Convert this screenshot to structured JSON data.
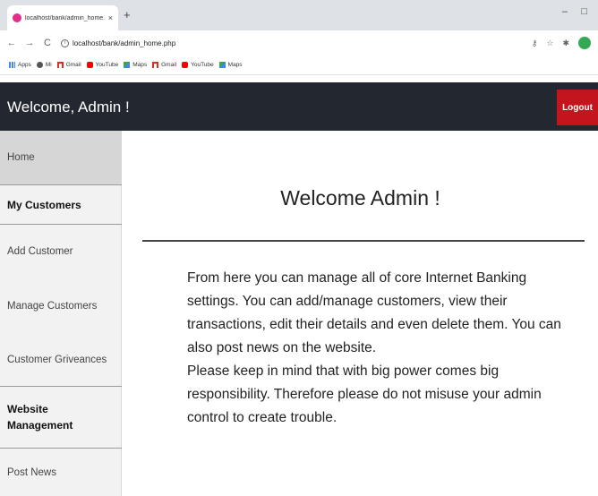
{
  "browser": {
    "tab_title": "localhost/bank/admin_home.php",
    "tab_close": "×",
    "new_tab": "+",
    "minimize": "–",
    "restore": "□",
    "back": "←",
    "forward": "→",
    "reload": "C",
    "url": "localhost/bank/admin_home.php",
    "bookmarks": [
      {
        "label": "Apps",
        "icon": "apps-icon"
      },
      {
        "label": "Mi",
        "icon": "mi-icon"
      },
      {
        "label": "Gmail",
        "icon": "gmail-icon"
      },
      {
        "label": "YouTube",
        "icon": "youtube-icon"
      },
      {
        "label": "Maps",
        "icon": "maps-icon"
      },
      {
        "label": "Gmail",
        "icon": "gmail-icon"
      },
      {
        "label": "YouTube",
        "icon": "youtube-icon"
      },
      {
        "label": "Maps",
        "icon": "maps-icon"
      }
    ]
  },
  "header": {
    "welcome": "Welcome,  Admin !",
    "logout": "Logout",
    "bg_color": "#232830",
    "logout_color": "#c4141e"
  },
  "sidebar": {
    "home": "Home",
    "my_customers": "My Customers",
    "add_customer": "Add Customer",
    "manage_customers": "Manage Customers",
    "customer_grievances": "Customer Griveances",
    "website_management_line1": "Website",
    "website_management_line2": "Management",
    "post_news": "Post News"
  },
  "main": {
    "title": "Welcome Admin !",
    "paragraph1": "From here you can manage all of core Internet Banking settings. You can add/manage customers, view their transactions, edit their details and even delete them. You can also post news on the website.",
    "paragraph2": "Please keep in mind that with big power comes big responsibility. Therefore please do not misuse your admin control to create trouble."
  }
}
